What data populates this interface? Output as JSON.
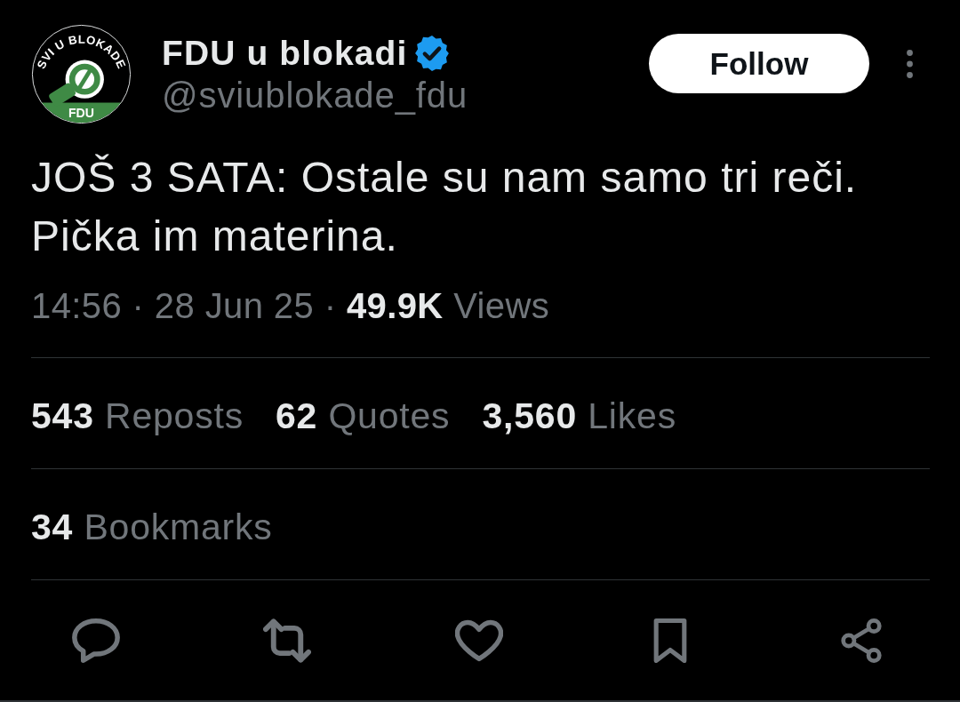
{
  "author": {
    "avatar": {
      "ring_text": "SVI U BLOKADE",
      "label": "FDU"
    },
    "name": "FDU u blokadi",
    "verified": true,
    "handle": "@sviublokade_fdu"
  },
  "follow_button": {
    "label": "Follow"
  },
  "tweet": {
    "text": "JOŠ 3 SATA: Ostale su nam samo tri reči.\nPička im materina.",
    "meta": "14:56 · 28 Jun 25 · **49.9K** Views"
  },
  "stats": [
    {
      "count": "543",
      "label": "Reposts"
    },
    {
      "count": "62",
      "label": "Quotes"
    },
    {
      "count": "3,560",
      "label": "Likes"
    }
  ],
  "bookmarks": {
    "count": "34",
    "label": "Bookmarks"
  },
  "actions": [
    {
      "kind": "reply"
    },
    {
      "kind": "repost"
    },
    {
      "kind": "like"
    },
    {
      "kind": "bookmark"
    },
    {
      "kind": "share"
    }
  ]
}
